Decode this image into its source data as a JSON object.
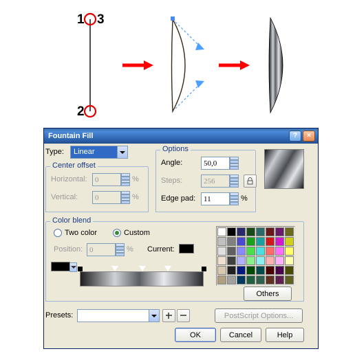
{
  "dialog": {
    "title": "Fountain Fill"
  },
  "type": {
    "label": "Type:",
    "value": "Linear"
  },
  "center_offset": {
    "title": "Center offset",
    "horizontal_label": "Horizontal:",
    "horizontal": "0",
    "vertical_label": "Vertical:",
    "vertical": "0"
  },
  "options": {
    "title": "Options",
    "angle_label": "Angle:",
    "angle": "50,0",
    "steps_label": "Steps:",
    "steps": "256",
    "edgepad_label": "Edge pad:",
    "edge_pad": "11"
  },
  "color_blend": {
    "title": "Color blend",
    "two_color": "Two color",
    "custom": "Custom",
    "position_label": "Position:",
    "position": "0",
    "current_label": "Current:",
    "others": "Others"
  },
  "presets": {
    "label": "Presets:",
    "value": ""
  },
  "postscript": "PostScript Options...",
  "buttons": {
    "ok": "OK",
    "cancel": "Cancel",
    "help": "Help"
  },
  "percent": "%",
  "palette_colors": [
    "#ffffff",
    "#000000",
    "#2a2a6a",
    "#1a4a1a",
    "#2a6a6a",
    "#6a1a1a",
    "#6a1a6a",
    "#6a6a1a",
    "#c0c0c0",
    "#808080",
    "#4a4ad0",
    "#1aa01a",
    "#1aa0a0",
    "#d01a1a",
    "#d01ad0",
    "#d0d01a",
    "#e0e0e0",
    "#606060",
    "#8a8aff",
    "#4ae04a",
    "#4ae0e0",
    "#ff6a6a",
    "#ff6aff",
    "#ffff6a",
    "#f0e0d0",
    "#404040",
    "#b0b0ff",
    "#8af08a",
    "#8af0f0",
    "#ffb0b0",
    "#ffb0ff",
    "#ffffb0",
    "#d8c8b0",
    "#202020",
    "#001a80",
    "#004a00",
    "#004a4a",
    "#4a0000",
    "#4a004a",
    "#4a4a00",
    "#b0a080",
    "#a0a0a0",
    "#003a60",
    "#206040",
    "#306050",
    "#603020",
    "#602050",
    "#606020"
  ],
  "illustration": {
    "steps": [
      "1",
      "3",
      "2"
    ]
  }
}
